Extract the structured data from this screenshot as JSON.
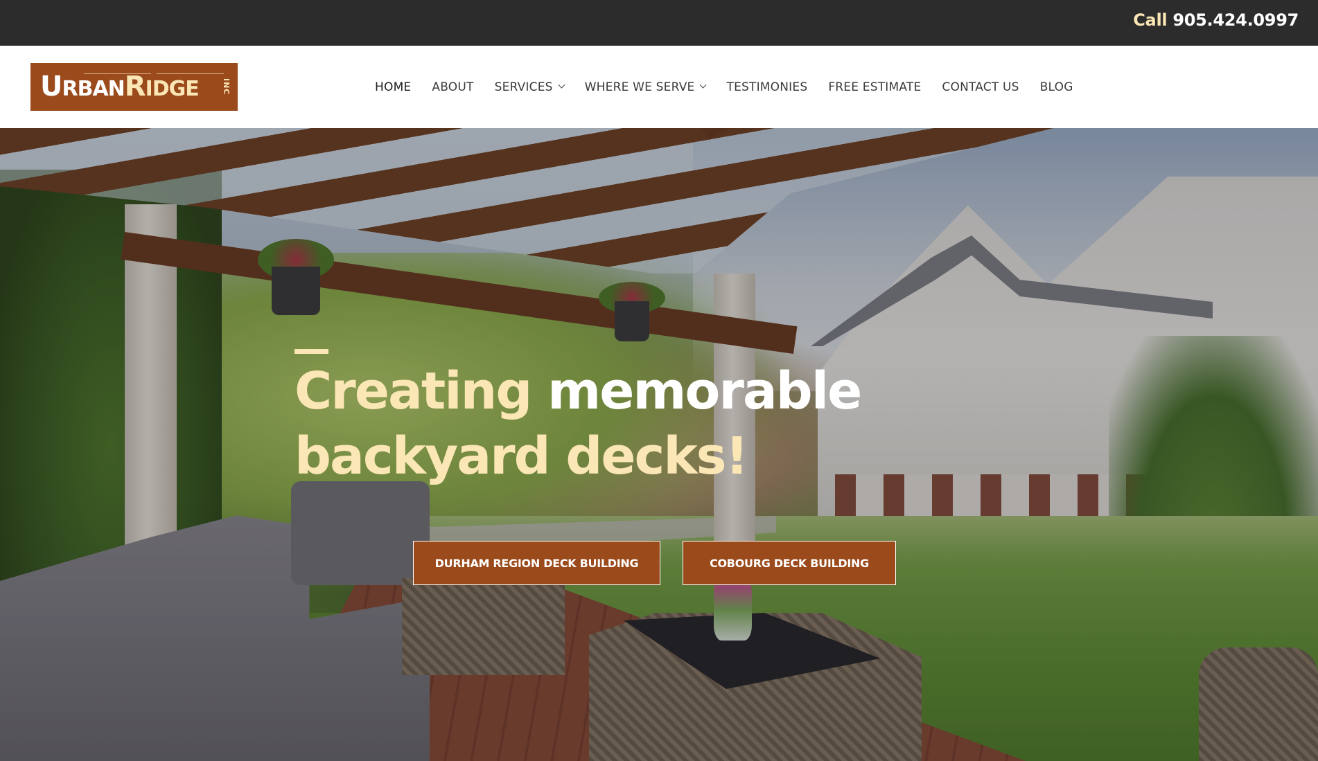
{
  "topbar": {
    "call_label": "Call",
    "phone": "905.424.0997"
  },
  "brand": {
    "logo_part1_initial": "U",
    "logo_part1_rest": "RBAN",
    "logo_part2_initial": "R",
    "logo_part2_rest": "IDGE",
    "logo_suffix": "INC",
    "colors": {
      "brand_brown": "#9a4a1b",
      "cream_accent": "#fbe6b5",
      "topbar_bg": "#2c2c2c"
    }
  },
  "nav": {
    "items": [
      {
        "label": "HOME",
        "active": true,
        "has_dropdown": false
      },
      {
        "label": "ABOUT",
        "active": false,
        "has_dropdown": false
      },
      {
        "label": "SERVICES",
        "active": false,
        "has_dropdown": true
      },
      {
        "label": "WHERE WE SERVE",
        "active": false,
        "has_dropdown": true
      },
      {
        "label": "TESTIMONIES",
        "active": false,
        "has_dropdown": false
      },
      {
        "label": "FREE ESTIMATE",
        "active": false,
        "has_dropdown": false
      },
      {
        "label": "CONTACT US",
        "active": false,
        "has_dropdown": false
      },
      {
        "label": "BLOG",
        "active": false,
        "has_dropdown": false
      }
    ]
  },
  "hero": {
    "title_highlight": "Creating",
    "title_white": "memorable",
    "title_line2": "backyard decks!",
    "background_image": "pergola-patio-backyard-photo",
    "buttons": [
      {
        "label": "DURHAM REGION DECK BUILDING"
      },
      {
        "label": "COBOURG DECK BUILDING"
      }
    ]
  }
}
